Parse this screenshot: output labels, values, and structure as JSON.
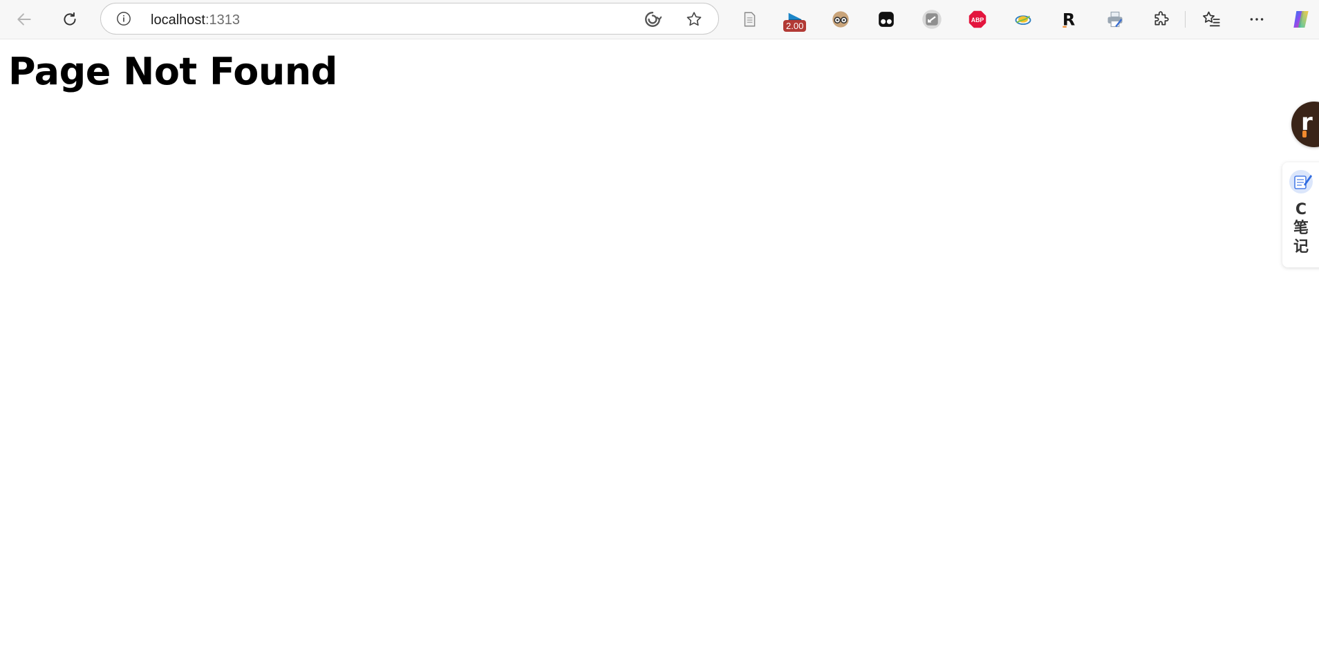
{
  "browser": {
    "address_host": "localhost",
    "address_port": ":1313",
    "icons": {
      "back": "back-arrow-icon",
      "reload": "reload-icon",
      "site_info": "info-icon",
      "tracking": "refresh-swirl-icon",
      "favorite": "star-icon",
      "extensions": "puzzle-icon",
      "favorites_bar": "favorites-icon",
      "more": "more-icon",
      "copilot": "copilot-icon"
    },
    "extensions": [
      {
        "name": "reader-icon"
      },
      {
        "name": "speed-extension-icon",
        "badge": "2.00"
      },
      {
        "name": "goggles-extension-icon"
      },
      {
        "name": "tampermonkey-icon"
      },
      {
        "name": "sync-extension-icon"
      },
      {
        "name": "adblock-plus-icon",
        "label": "ABP"
      },
      {
        "name": "translate-extension-icon"
      },
      {
        "name": "r-extension-icon",
        "label": "R"
      },
      {
        "name": "printer-extension-icon"
      }
    ]
  },
  "page": {
    "heading": "Page Not Found"
  },
  "floating": {
    "r_button_label": "r",
    "note_label": "C笔记"
  },
  "colors": {
    "badge": "#b23a35",
    "adblock": "#e3153d",
    "r_button": "#3a2418"
  }
}
